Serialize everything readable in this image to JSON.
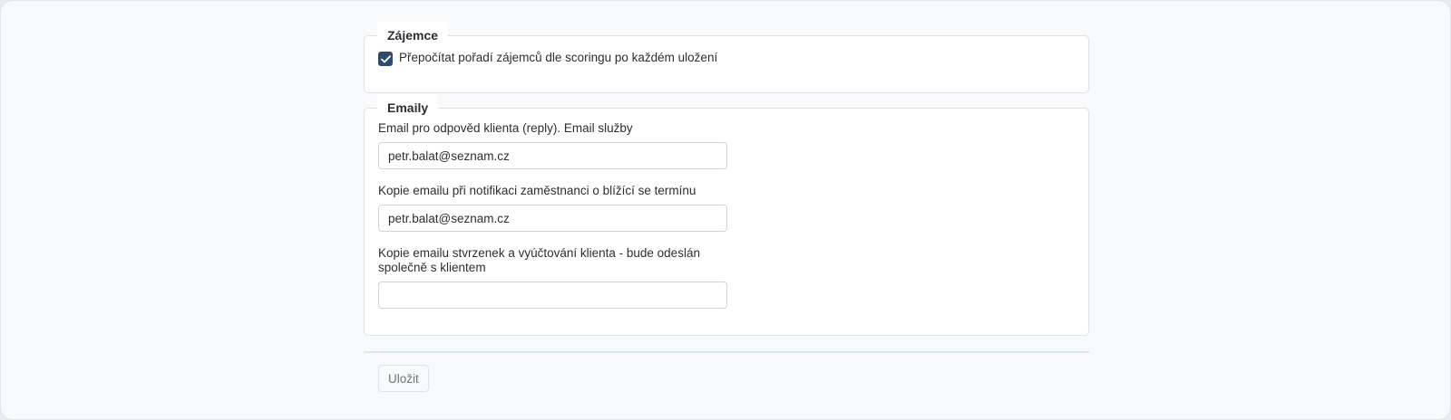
{
  "sections": {
    "zajemce": {
      "legend": "Zájemce",
      "recalculate_checkbox": {
        "label": "Přepočítat pořadí zájemců dle scoringu po každém uložení",
        "checked": true
      }
    },
    "emaily": {
      "legend": "Emaily",
      "fields": [
        {
          "label": "Email pro odpověd klienta (reply). Email služby",
          "value": "petr.balat@seznam.cz",
          "placeholder": ""
        },
        {
          "label": "Kopie emailu při notifikaci zaměstnanci o blížící se termínu",
          "value": "petr.balat@seznam.cz",
          "placeholder": ""
        },
        {
          "label": "Kopie emailu stvrzenek a vyúčtování klienta - bude odeslán společně s klientem",
          "value": "",
          "placeholder": ""
        }
      ]
    }
  },
  "actions": {
    "save_label": "Uložit"
  },
  "colors": {
    "checkbox_fill": "#2f4a6e",
    "divider": "#d6e9f3",
    "panel_background": "#f8f9fa"
  },
  "icons": {
    "checkbox_mark": "checkmark-icon"
  }
}
